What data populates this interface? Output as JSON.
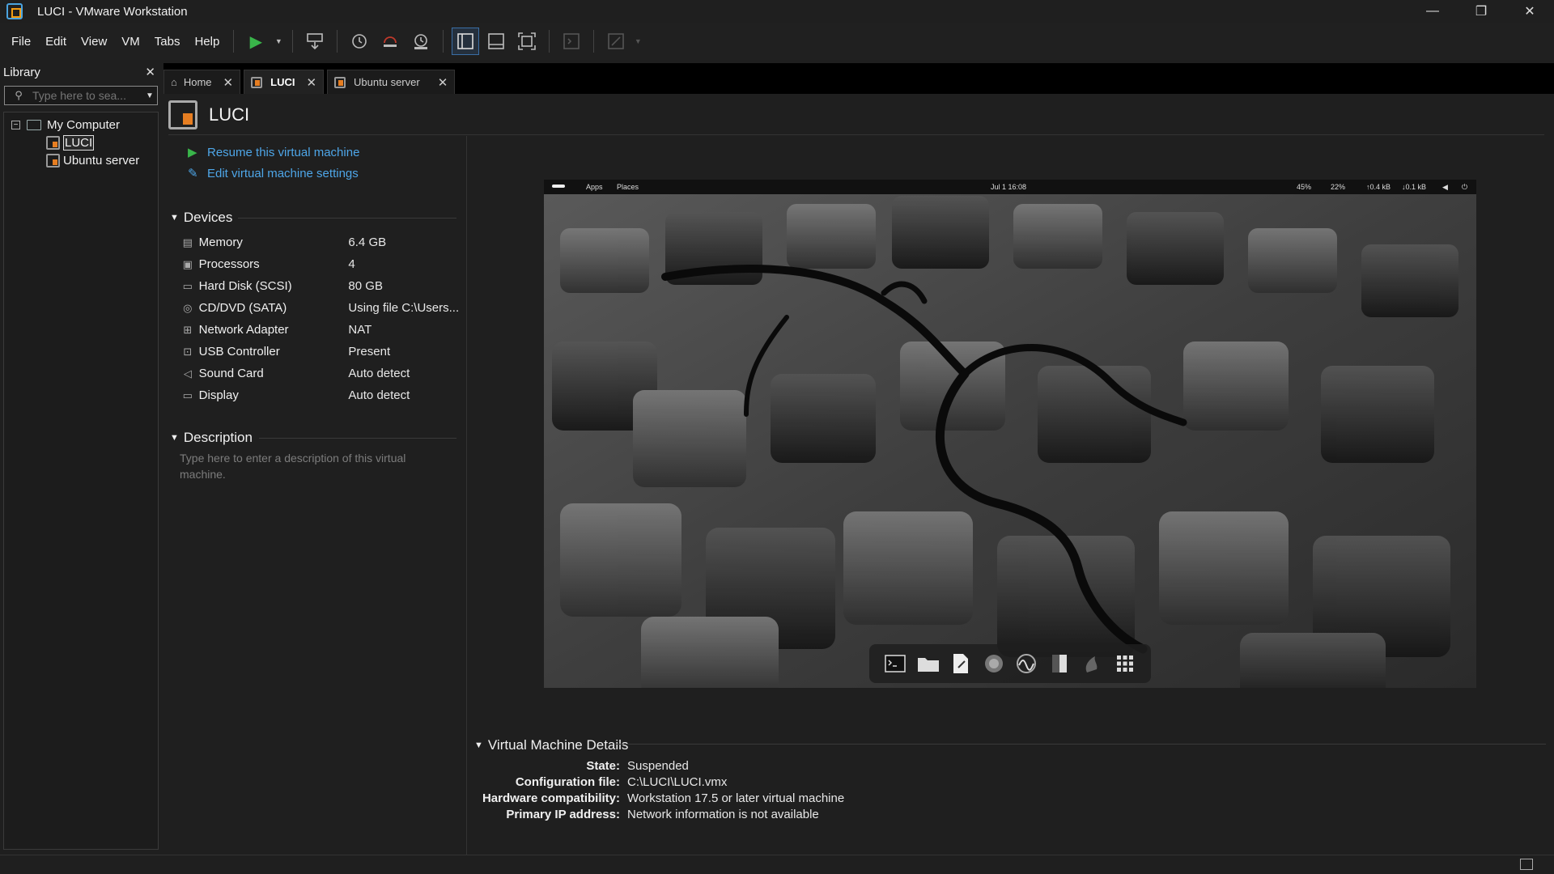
{
  "window": {
    "title": "LUCI - VMware Workstation",
    "minimize": "—",
    "restore": "❐",
    "close": "✕"
  },
  "menu": [
    "File",
    "Edit",
    "View",
    "VM",
    "Tabs",
    "Help"
  ],
  "library": {
    "title": "Library",
    "search_placeholder": "Type here to sea...",
    "tree": {
      "root": "My Computer",
      "items": [
        "LUCI",
        "Ubuntu server"
      ]
    }
  },
  "tabs": [
    {
      "label": "Home",
      "active": false
    },
    {
      "label": "LUCI",
      "active": true
    },
    {
      "label": "Ubuntu server",
      "active": false
    }
  ],
  "vm": {
    "name": "LUCI",
    "commands": {
      "resume": "Resume this virtual machine",
      "edit": "Edit virtual machine settings"
    },
    "devices_title": "Devices",
    "devices": [
      {
        "name": "Memory",
        "value": "6.4 GB",
        "icon": "memory-icon"
      },
      {
        "name": "Processors",
        "value": "4",
        "icon": "processor-icon"
      },
      {
        "name": "Hard Disk (SCSI)",
        "value": "80 GB",
        "icon": "hard-disk-icon"
      },
      {
        "name": "CD/DVD (SATA)",
        "value": "Using file C:\\Users...",
        "icon": "cd-dvd-icon"
      },
      {
        "name": "Network Adapter",
        "value": "NAT",
        "icon": "network-adapter-icon"
      },
      {
        "name": "USB Controller",
        "value": "Present",
        "icon": "usb-icon"
      },
      {
        "name": "Sound Card",
        "value": "Auto detect",
        "icon": "sound-card-icon"
      },
      {
        "name": "Display",
        "value": "Auto detect",
        "icon": "display-icon"
      }
    ],
    "description_title": "Description",
    "description_placeholder": "Type here to enter a description of this virtual machine.",
    "details_title": "Virtual Machine Details",
    "details": [
      {
        "label": "State:",
        "value": "Suspended"
      },
      {
        "label": "Configuration file:",
        "value": "C:\\LUCI\\LUCI.vmx"
      },
      {
        "label": "Hardware compatibility:",
        "value": "Workstation 17.5 or later virtual machine"
      },
      {
        "label": "Primary IP address:",
        "value": "Network information is not available"
      }
    ]
  },
  "preview": {
    "topbar": {
      "apps": "Apps",
      "places": "Places",
      "clock": "Jul 1  16:08",
      "battery": "45%",
      "cpu": "22%",
      "net_up": "↑0.4 kB",
      "net_down": "↓0.1 kB"
    },
    "dock": [
      "terminal-icon",
      "file-manager-icon",
      "text-editor-icon",
      "browser-icon",
      "monitor-icon",
      "power-icon",
      "kali-icon",
      "app-grid-icon"
    ]
  },
  "colors": {
    "accent_link": "#4ea6e8",
    "play_green": "#39b54a",
    "vm_orange": "#e67e22"
  }
}
